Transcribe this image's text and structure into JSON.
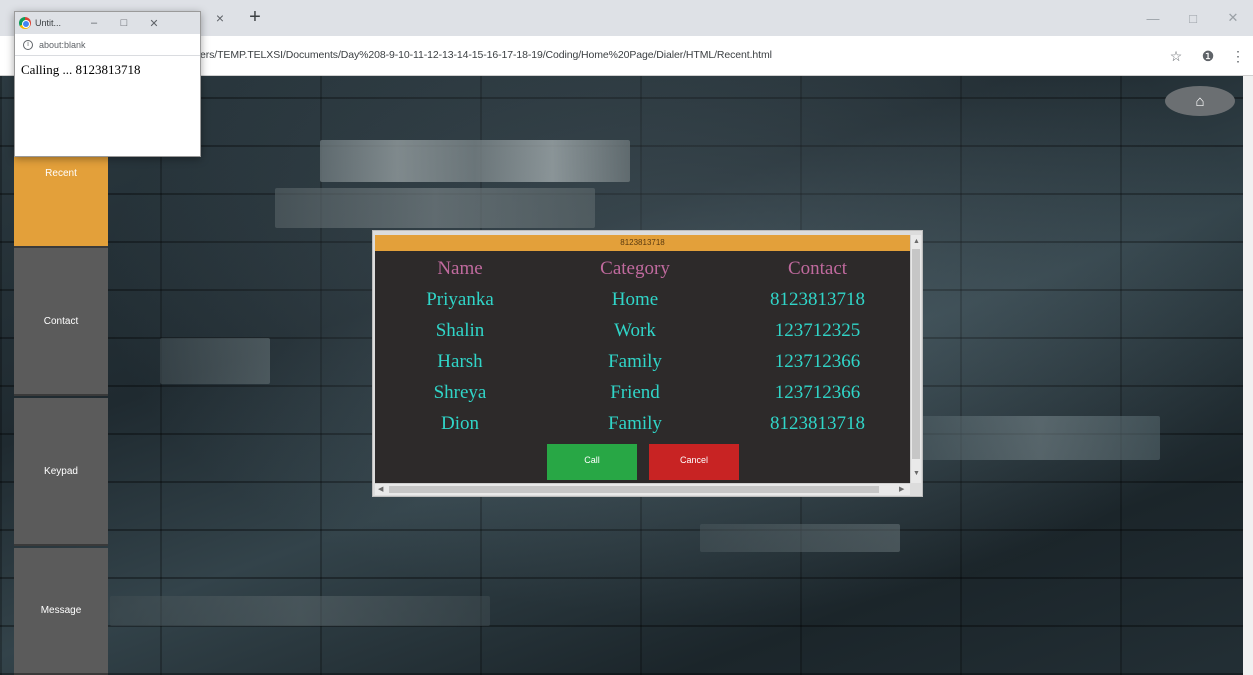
{
  "browser": {
    "tab_close": "×",
    "new_tab": "+",
    "url": "ers/TEMP.TELXSI/Documents/Day%208-9-10-11-12-13-14-15-16-17-18-19/Coding/Home%20Page/Dialer/HTML/Recent.html",
    "star_icon": "☆",
    "account_icon": "❶",
    "menu_icon": "⋮",
    "minimize": "—",
    "restore": "□",
    "close": "✕"
  },
  "popup": {
    "title": "Untit...",
    "minimize": "–",
    "maximize": "□",
    "close": "✕",
    "url": "about:blank",
    "message": "Calling ... 8123813718"
  },
  "sidebar": {
    "items": [
      {
        "label": "Recent"
      },
      {
        "label": "Contact"
      },
      {
        "label": "Keypad"
      },
      {
        "label": "Message"
      }
    ]
  },
  "home_icon": "⌂",
  "dialog": {
    "header": "8123813718",
    "columns": [
      "Name",
      "Category",
      "Contact"
    ],
    "rows": [
      [
        "Priyanka",
        "Home",
        "8123813718"
      ],
      [
        "Shalin",
        "Work",
        "123712325"
      ],
      [
        "Harsh",
        "Family",
        "123712366"
      ],
      [
        "Shreya",
        "Friend",
        "123712366"
      ],
      [
        "Dion",
        "Family",
        "8123813718"
      ]
    ],
    "call_label": "Call",
    "cancel_label": "Cancel"
  },
  "colors": {
    "accent_orange": "#e3a03a",
    "header_text": "#c06a9e",
    "cell_text": "#30d5c8",
    "call_green": "#28a745",
    "cancel_red": "#c82323"
  }
}
